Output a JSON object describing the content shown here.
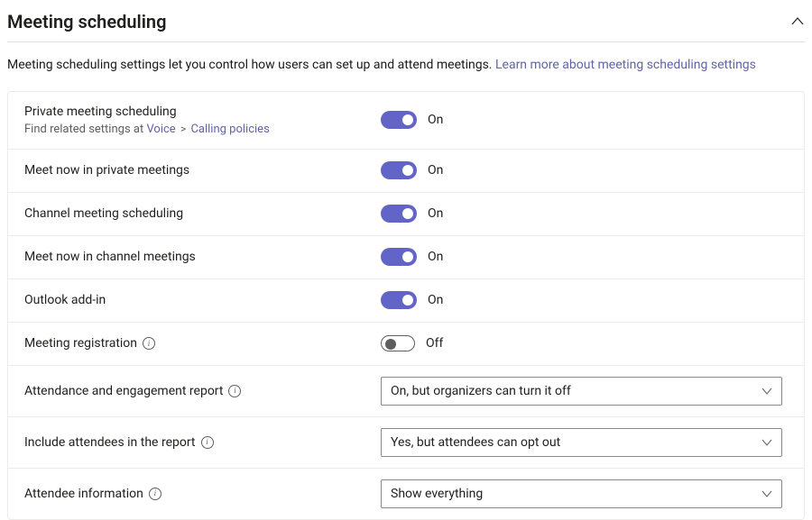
{
  "header": {
    "title": "Meeting scheduling"
  },
  "description": {
    "text": "Meeting scheduling settings let you control how users can set up and attend meetings. ",
    "link": "Learn more about meeting scheduling settings"
  },
  "settings": {
    "private_meeting": {
      "label": "Private meeting scheduling",
      "hint_prefix": "Find related settings at ",
      "hint_link1": "Voice",
      "hint_sep": ">",
      "hint_link2": "Calling policies",
      "state": "On"
    },
    "meet_now_private": {
      "label": "Meet now in private meetings",
      "state": "On"
    },
    "channel_scheduling": {
      "label": "Channel meeting scheduling",
      "state": "On"
    },
    "meet_now_channel": {
      "label": "Meet now in channel meetings",
      "state": "On"
    },
    "outlook_addin": {
      "label": "Outlook add-in",
      "state": "On"
    },
    "meeting_registration": {
      "label": "Meeting registration",
      "state": "Off"
    },
    "attendance_report": {
      "label": "Attendance and engagement report",
      "value": "On, but organizers can turn it off"
    },
    "include_attendees": {
      "label": "Include attendees in the report",
      "value": "Yes, but attendees can opt out"
    },
    "attendee_info": {
      "label": "Attendee information",
      "value": "Show everything"
    }
  }
}
